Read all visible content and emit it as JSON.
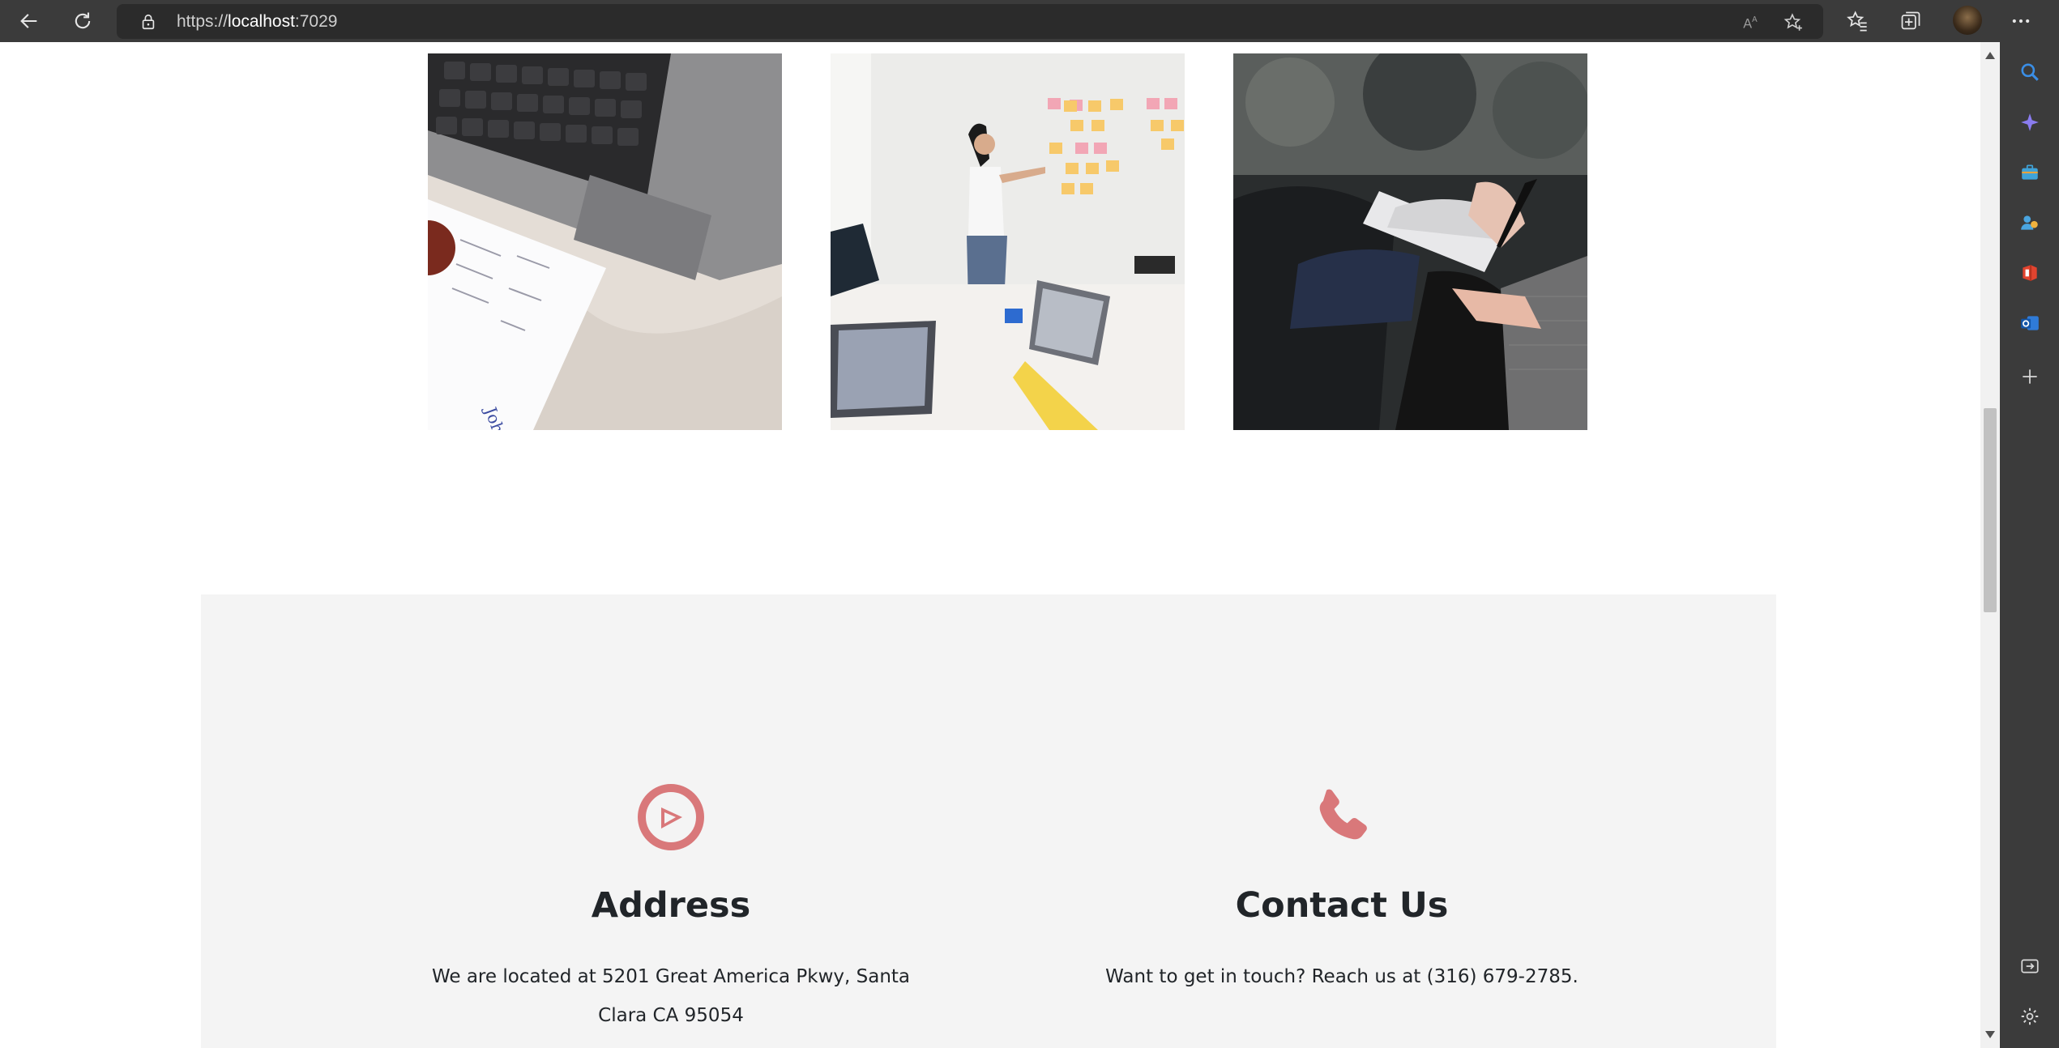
{
  "browser": {
    "url_scheme": "https://",
    "url_host": "localhost",
    "url_port": ":7029"
  },
  "gallery": {
    "images": [
      {
        "name": "laptop-resume-photo"
      },
      {
        "name": "whiteboard-sticky-notes-photo"
      },
      {
        "name": "people-taking-notes-photo"
      }
    ]
  },
  "info": {
    "address": {
      "title": "Address",
      "text": "We are located at 5201 Great America Pkwy, Santa Clara CA 95054",
      "icon": "map-marker-icon"
    },
    "contact": {
      "title": "Contact Us",
      "text": "Want to get in touch? Reach us at (316) 679-2785.",
      "icon": "phone-icon"
    },
    "accent_color": "#d9787a"
  }
}
